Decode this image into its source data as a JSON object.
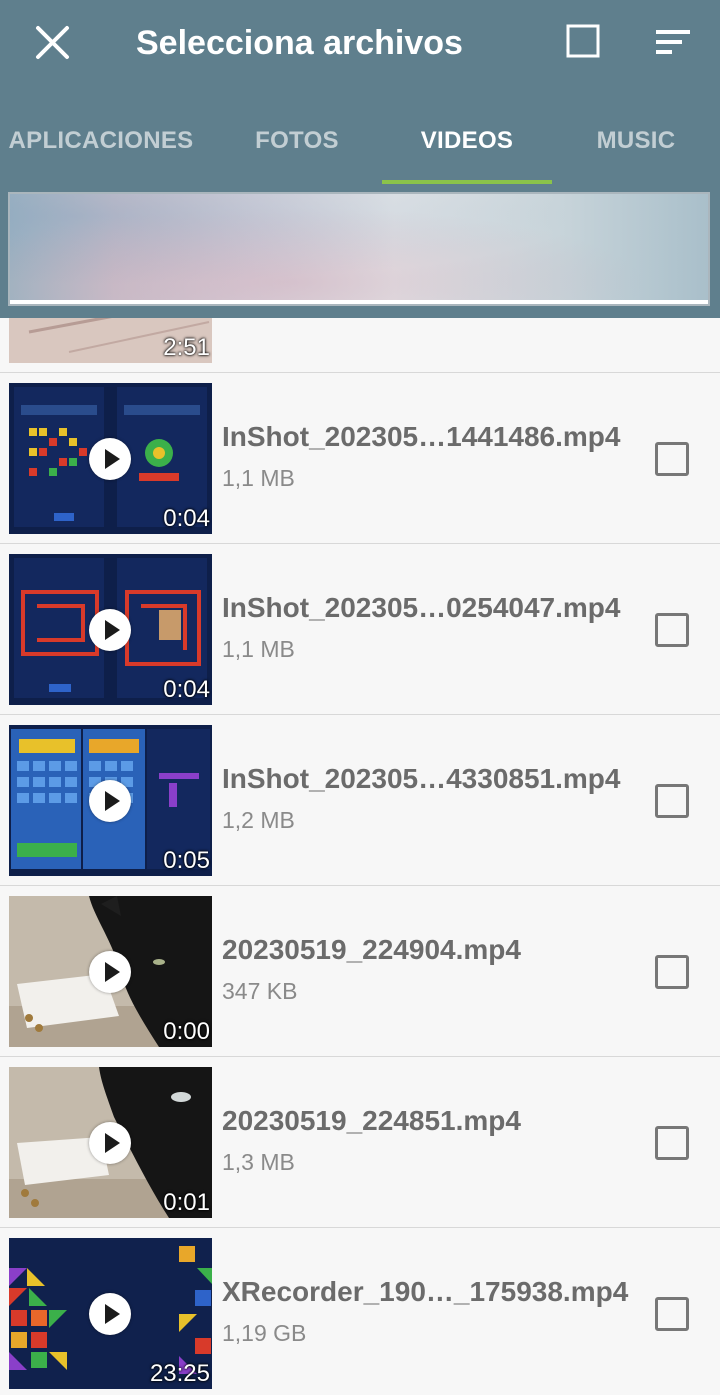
{
  "header": {
    "title": "Selecciona archivos",
    "icons": {
      "close": "close-icon",
      "select_all": "checkbox-outline-icon",
      "sort": "sort-icon"
    },
    "colors": {
      "bar": "#5f7f8d",
      "indicator": "#8bc34a"
    }
  },
  "tabs": [
    {
      "label": "APLICACIONES",
      "active": false
    },
    {
      "label": "FOTOS",
      "active": false
    },
    {
      "label": "VIDEOS",
      "active": true
    },
    {
      "label": "MUSIC",
      "active": false
    }
  ],
  "partial_row": {
    "duration": "2:51"
  },
  "files": [
    {
      "name": "InShot_202305…1441486.mp4",
      "size": "1,1 MB",
      "duration": "0:04",
      "thumb": "game-blocks",
      "checked": false
    },
    {
      "name": "InShot_202305…0254047.mp4",
      "size": "1,1 MB",
      "duration": "0:04",
      "thumb": "game-maze",
      "checked": false
    },
    {
      "name": "InShot_202305…4330851.mp4",
      "size": "1,2 MB",
      "duration": "0:05",
      "thumb": "game-grid",
      "checked": false
    },
    {
      "name": "20230519_224904.mp4",
      "size": "347 KB",
      "duration": "0:00",
      "thumb": "black-cat",
      "checked": false
    },
    {
      "name": "20230519_224851.mp4",
      "size": "1,3 MB",
      "duration": "0:01",
      "thumb": "black-cat",
      "checked": false
    },
    {
      "name": "XRecorder_190…_175938.mp4",
      "size": "1,19 GB",
      "duration": "23:25",
      "thumb": "game-triangles",
      "checked": false
    }
  ]
}
